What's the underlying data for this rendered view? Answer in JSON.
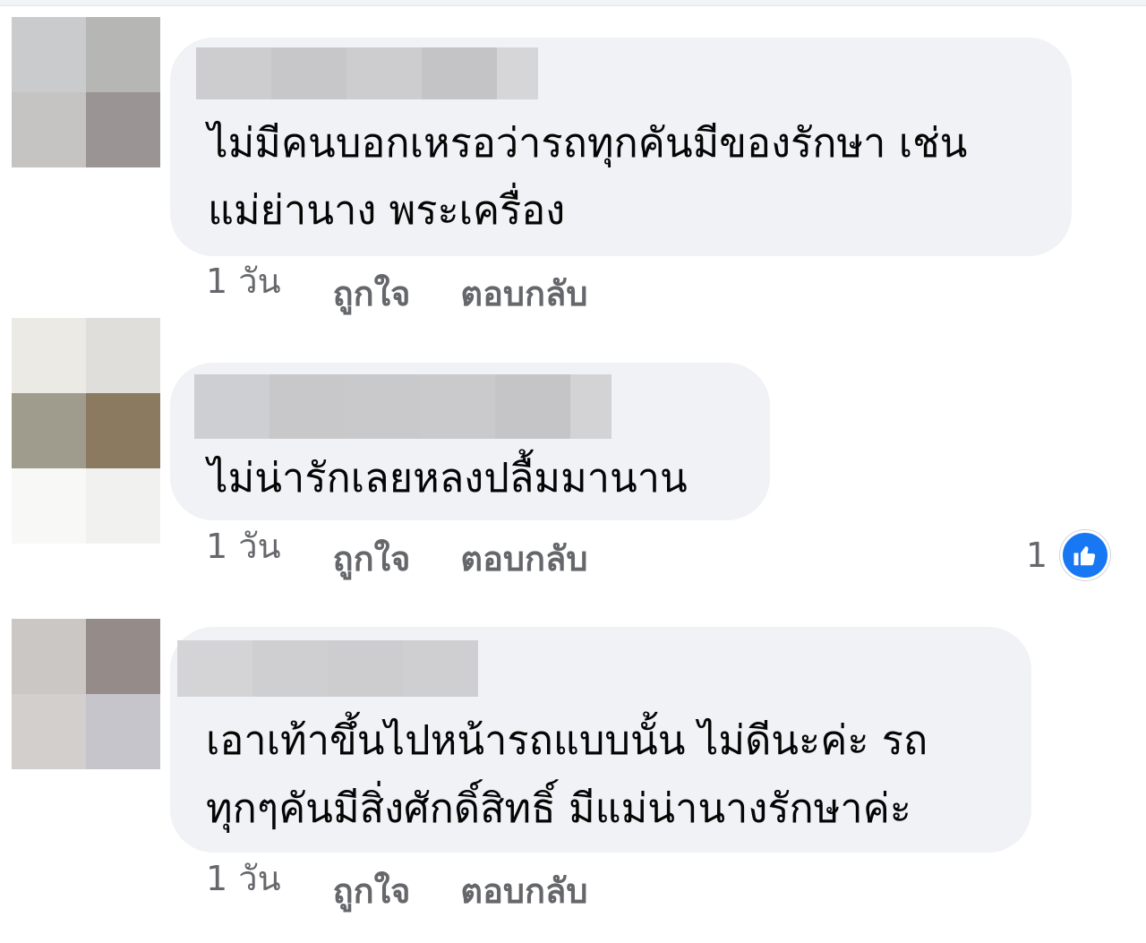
{
  "comments": [
    {
      "text_lines": [
        "ไม่มีคนบอกเหรอว่ารถทุกคันมีของรักษา เช่น",
        "แม่ย่านาง พระเครื่อง"
      ],
      "time": "1 วัน",
      "like_label": "ถูกใจ",
      "reply_label": "ตอบกลับ",
      "avatar_colors": [
        "#cacbcd",
        "#b6b6b4",
        "#c5c4c2",
        "#9a9594"
      ],
      "name_blur_colors": [
        "#cdcdd0",
        "#c7c7ca",
        "#cdcdd0",
        "#c4c3c6",
        "#d6d6d9"
      ]
    },
    {
      "text_lines": [
        "ไม่น่ารักเลยหลงปลื้มมานาน"
      ],
      "time": "1 วัน",
      "like_label": "ถูกใจ",
      "reply_label": "ตอบกลับ",
      "reaction_count": "1",
      "reaction_icon": "thumbs-up-icon",
      "avatar_colors": [
        "#eceae5",
        "#dfdeda",
        "#a09c8d",
        "#8b7a5f",
        "#f8f8f7",
        "#f1f1ef"
      ],
      "name_blur_colors": [
        "#cecfd2",
        "#c8c8cb",
        "#c9c9cc",
        "#cacacd",
        "#c5c5c8",
        "#d3d3d6"
      ]
    },
    {
      "text_lines": [
        "เอาเท้าขึ้นไปหน้ารถแบบนั้น ไม่ดีนะค่ะ  รถ",
        "ทุกๆคันมีสิ่งศักดิ์สิทธิ์ มีแม่น่านางรักษาค่ะ"
      ],
      "time": "1 วัน",
      "like_label": "ถูกใจ",
      "reply_label": "ตอบกลับ",
      "avatar_colors": [
        "#cbc7c5",
        "#958b88",
        "#d2cfcd",
        "#c6c5cb"
      ],
      "name_blur_colors": [
        "#d4d4d7",
        "#cfcfd2",
        "#cdcdd0",
        "#cfcfd2"
      ]
    }
  ],
  "colors": {
    "bubble": "#f0f2f5",
    "text": "#050505",
    "meta": "#65676b",
    "like_blue": "#1877f2"
  }
}
